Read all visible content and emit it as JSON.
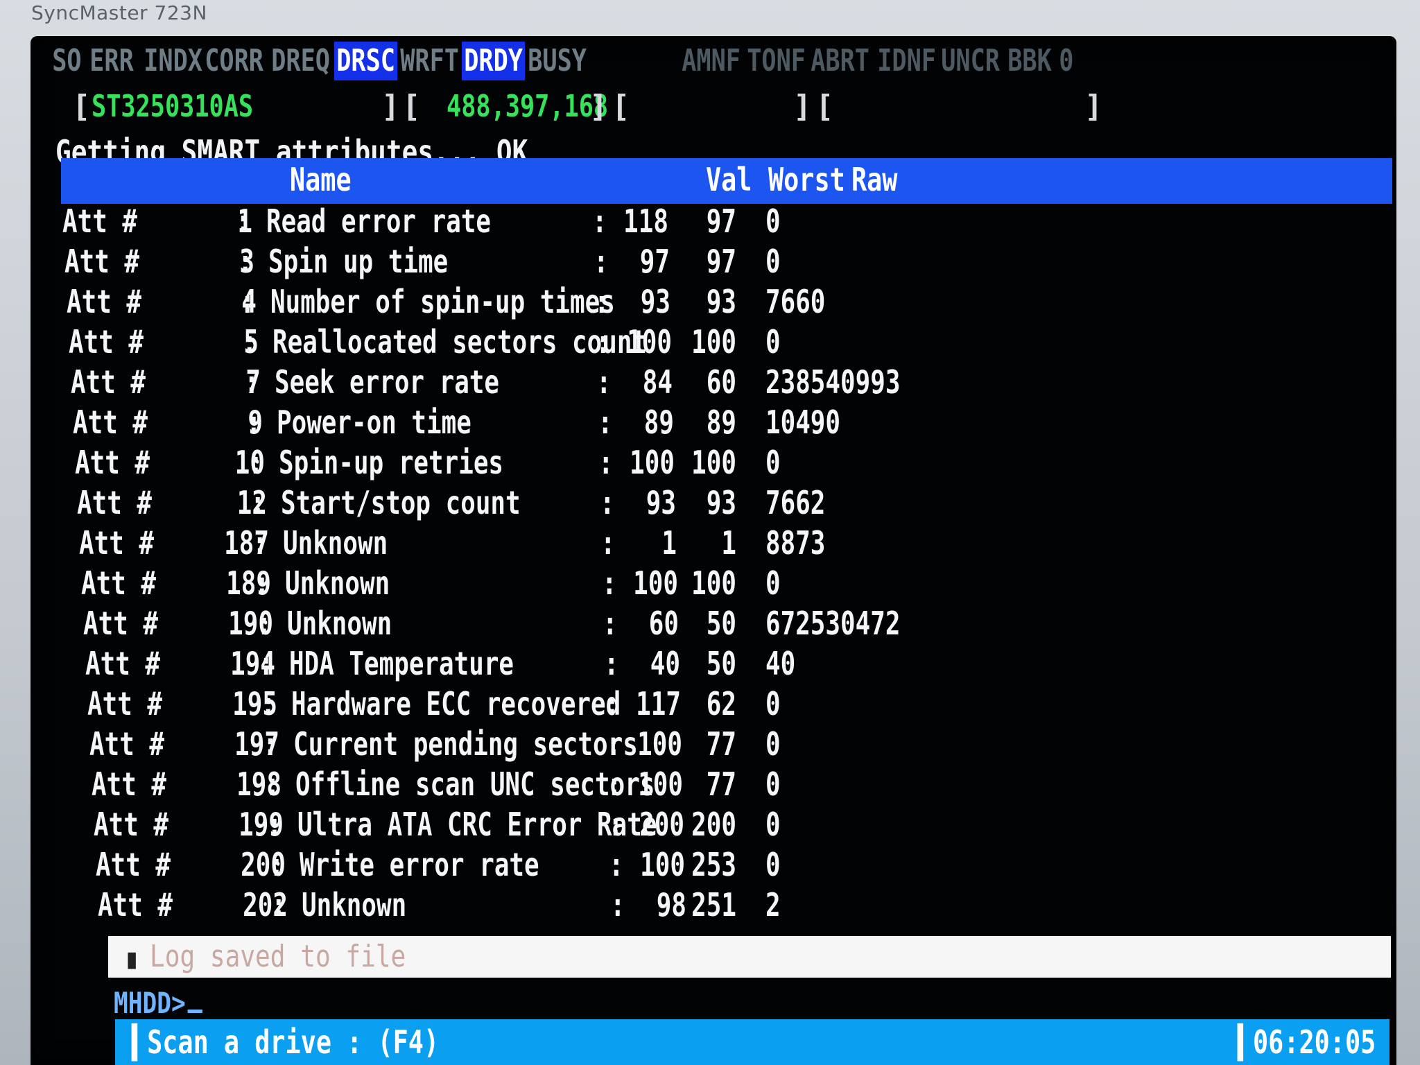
{
  "monitor": {
    "brand": "SyncMaster 723N"
  },
  "registers": [
    {
      "label": "SO",
      "active": false
    },
    {
      "label": "ERR",
      "active": false
    },
    {
      "label": "INDX",
      "active": false
    },
    {
      "label": "CORR",
      "active": false
    },
    {
      "label": "DREQ",
      "active": false
    },
    {
      "label": "DRSC",
      "active": true
    },
    {
      "label": "WRFT",
      "active": false
    },
    {
      "label": "DRDY",
      "active": true
    },
    {
      "label": "BUSY",
      "active": false
    },
    {
      "label": "AMNF",
      "active": false
    },
    {
      "label": "TONF",
      "active": false
    },
    {
      "label": "ABRT",
      "active": false
    },
    {
      "label": "IDNF",
      "active": false
    },
    {
      "label": "UNCR",
      "active": false
    },
    {
      "label": "BBK",
      "active": false
    },
    {
      "label": "0",
      "active": false
    }
  ],
  "drive": {
    "model": "ST3250310AS",
    "capacity": "488,397,168",
    "bracket_open": "[",
    "bracket_close": "]"
  },
  "status_line": "Getting SMART attributes... OK",
  "table": {
    "headers": {
      "name": "Name",
      "val": "Val",
      "worst": "Worst",
      "raw": "Raw"
    },
    "prefix": "Att #",
    "separator": ":",
    "rows": [
      {
        "id": "1",
        "name": "Read error rate",
        "val": "118",
        "worst": "97",
        "raw": "0"
      },
      {
        "id": "3",
        "name": "Spin up time",
        "val": "97",
        "worst": "97",
        "raw": "0"
      },
      {
        "id": "4",
        "name": "Number of spin-up times",
        "val": "93",
        "worst": "93",
        "raw": "7660"
      },
      {
        "id": "5",
        "name": "Reallocated sectors count",
        "val": "100",
        "worst": "100",
        "raw": "0"
      },
      {
        "id": "7",
        "name": "Seek error rate",
        "val": "84",
        "worst": "60",
        "raw": "238540993"
      },
      {
        "id": "9",
        "name": "Power-on time",
        "val": "89",
        "worst": "89",
        "raw": "10490"
      },
      {
        "id": "10",
        "name": "Spin-up retries",
        "val": "100",
        "worst": "100",
        "raw": "0"
      },
      {
        "id": "12",
        "name": "Start/stop count",
        "val": "93",
        "worst": "93",
        "raw": "7662"
      },
      {
        "id": "187",
        "name": "Unknown",
        "val": "1",
        "worst": "1",
        "raw": "8873"
      },
      {
        "id": "189",
        "name": "Unknown",
        "val": "100",
        "worst": "100",
        "raw": "0"
      },
      {
        "id": "190",
        "name": "Unknown",
        "val": "60",
        "worst": "50",
        "raw": "672530472"
      },
      {
        "id": "194",
        "name": "HDA Temperature",
        "val": "40",
        "worst": "50",
        "raw": "40"
      },
      {
        "id": "195",
        "name": "Hardware ECC recovered",
        "val": "117",
        "worst": "62",
        "raw": "0"
      },
      {
        "id": "197",
        "name": "Current pending sectors",
        "val": "100",
        "worst": "77",
        "raw": "0"
      },
      {
        "id": "198",
        "name": "Offline scan UNC sectors",
        "val": "100",
        "worst": "77",
        "raw": "0"
      },
      {
        "id": "199",
        "name": "Ultra ATA CRC Error Rate",
        "val": "200",
        "worst": "200",
        "raw": "0"
      },
      {
        "id": "200",
        "name": "Write error rate",
        "val": "100",
        "worst": "253",
        "raw": "0"
      },
      {
        "id": "202",
        "name": "Unknown",
        "val": "98",
        "worst": "251",
        "raw": "2"
      }
    ]
  },
  "log": {
    "bullet": "▮",
    "text": "Log saved to file"
  },
  "prompt": {
    "text": "MHDD>"
  },
  "bottom_bar": {
    "hint": "▍Scan a drive : (F4)",
    "clock": "▍06:20:05"
  },
  "colors": {
    "screen_bg": "#010305",
    "header_blue": "#1d55f0",
    "active_flag": "#1430e8",
    "model_green": "#36e25a",
    "status_bar": "#0a9ff0"
  }
}
